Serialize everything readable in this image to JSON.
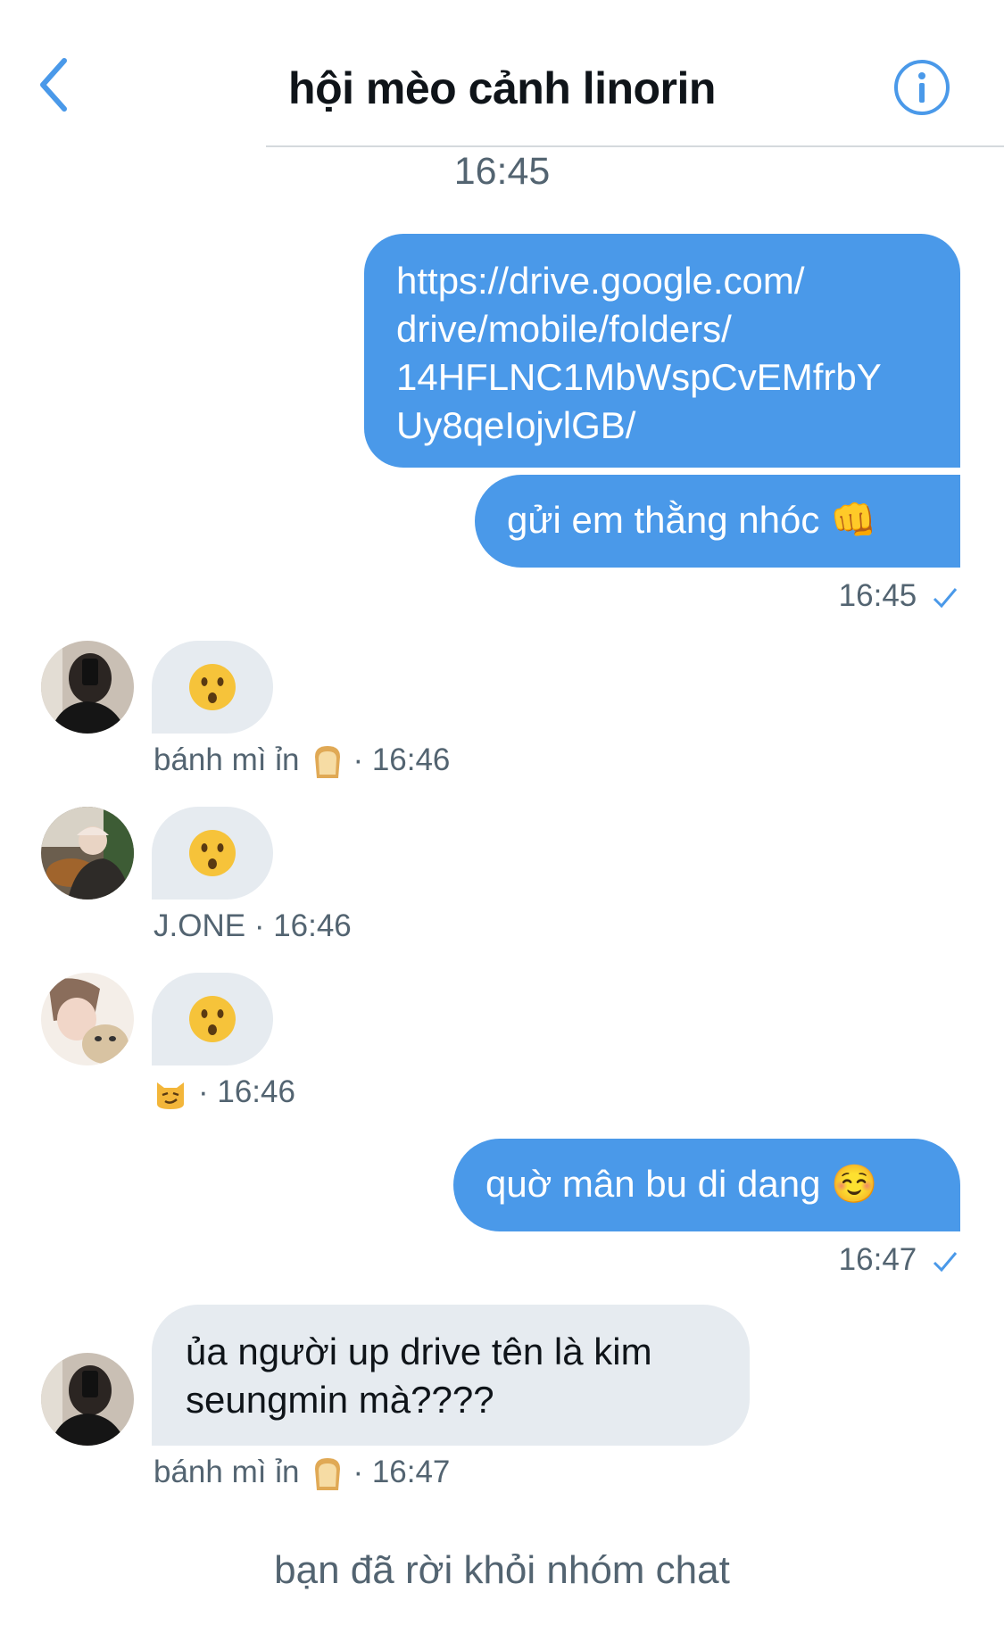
{
  "header": {
    "title": "hội mèo cảnh linorin",
    "back_icon": "chevron-left-icon",
    "info_icon": "info-circle-icon"
  },
  "colors": {
    "accent": "#4a99e9",
    "incoming_bubble": "#e6ebf0",
    "meta_text": "#536471"
  },
  "conversation": {
    "time_separator": "16:45",
    "outgoing_1": {
      "link_lines": [
        "https://drive.google.com/",
        "drive/mobile/folders/",
        "14HFLNC1MbWspCvEMfrbY",
        "Uy8qeIojvlGB/"
      ],
      "text": "gửi em thằng nhóc 👊",
      "time": "16:45"
    },
    "reaction_1": {
      "emoji": "😯",
      "sender": "bánh mì ỉn",
      "sender_emoji": "🍞",
      "time": "· 16:46"
    },
    "reaction_2": {
      "emoji": "😯",
      "sender": "J.ONE",
      "time": "· 16:46"
    },
    "reaction_3": {
      "emoji": "😯",
      "sender_emoji": "😼",
      "time": "· 16:46"
    },
    "outgoing_2": {
      "text": "quờ mân bu di dang ☺️",
      "time": "16:47"
    },
    "incoming_4": {
      "lines": [
        "ủa người up drive tên là kim",
        "seungmin mà????"
      ],
      "sender": "bánh mì ỉn",
      "sender_emoji": "🍞",
      "time": "· 16:47"
    },
    "left_notice": "bạn đã rời khỏi nhóm chat"
  }
}
